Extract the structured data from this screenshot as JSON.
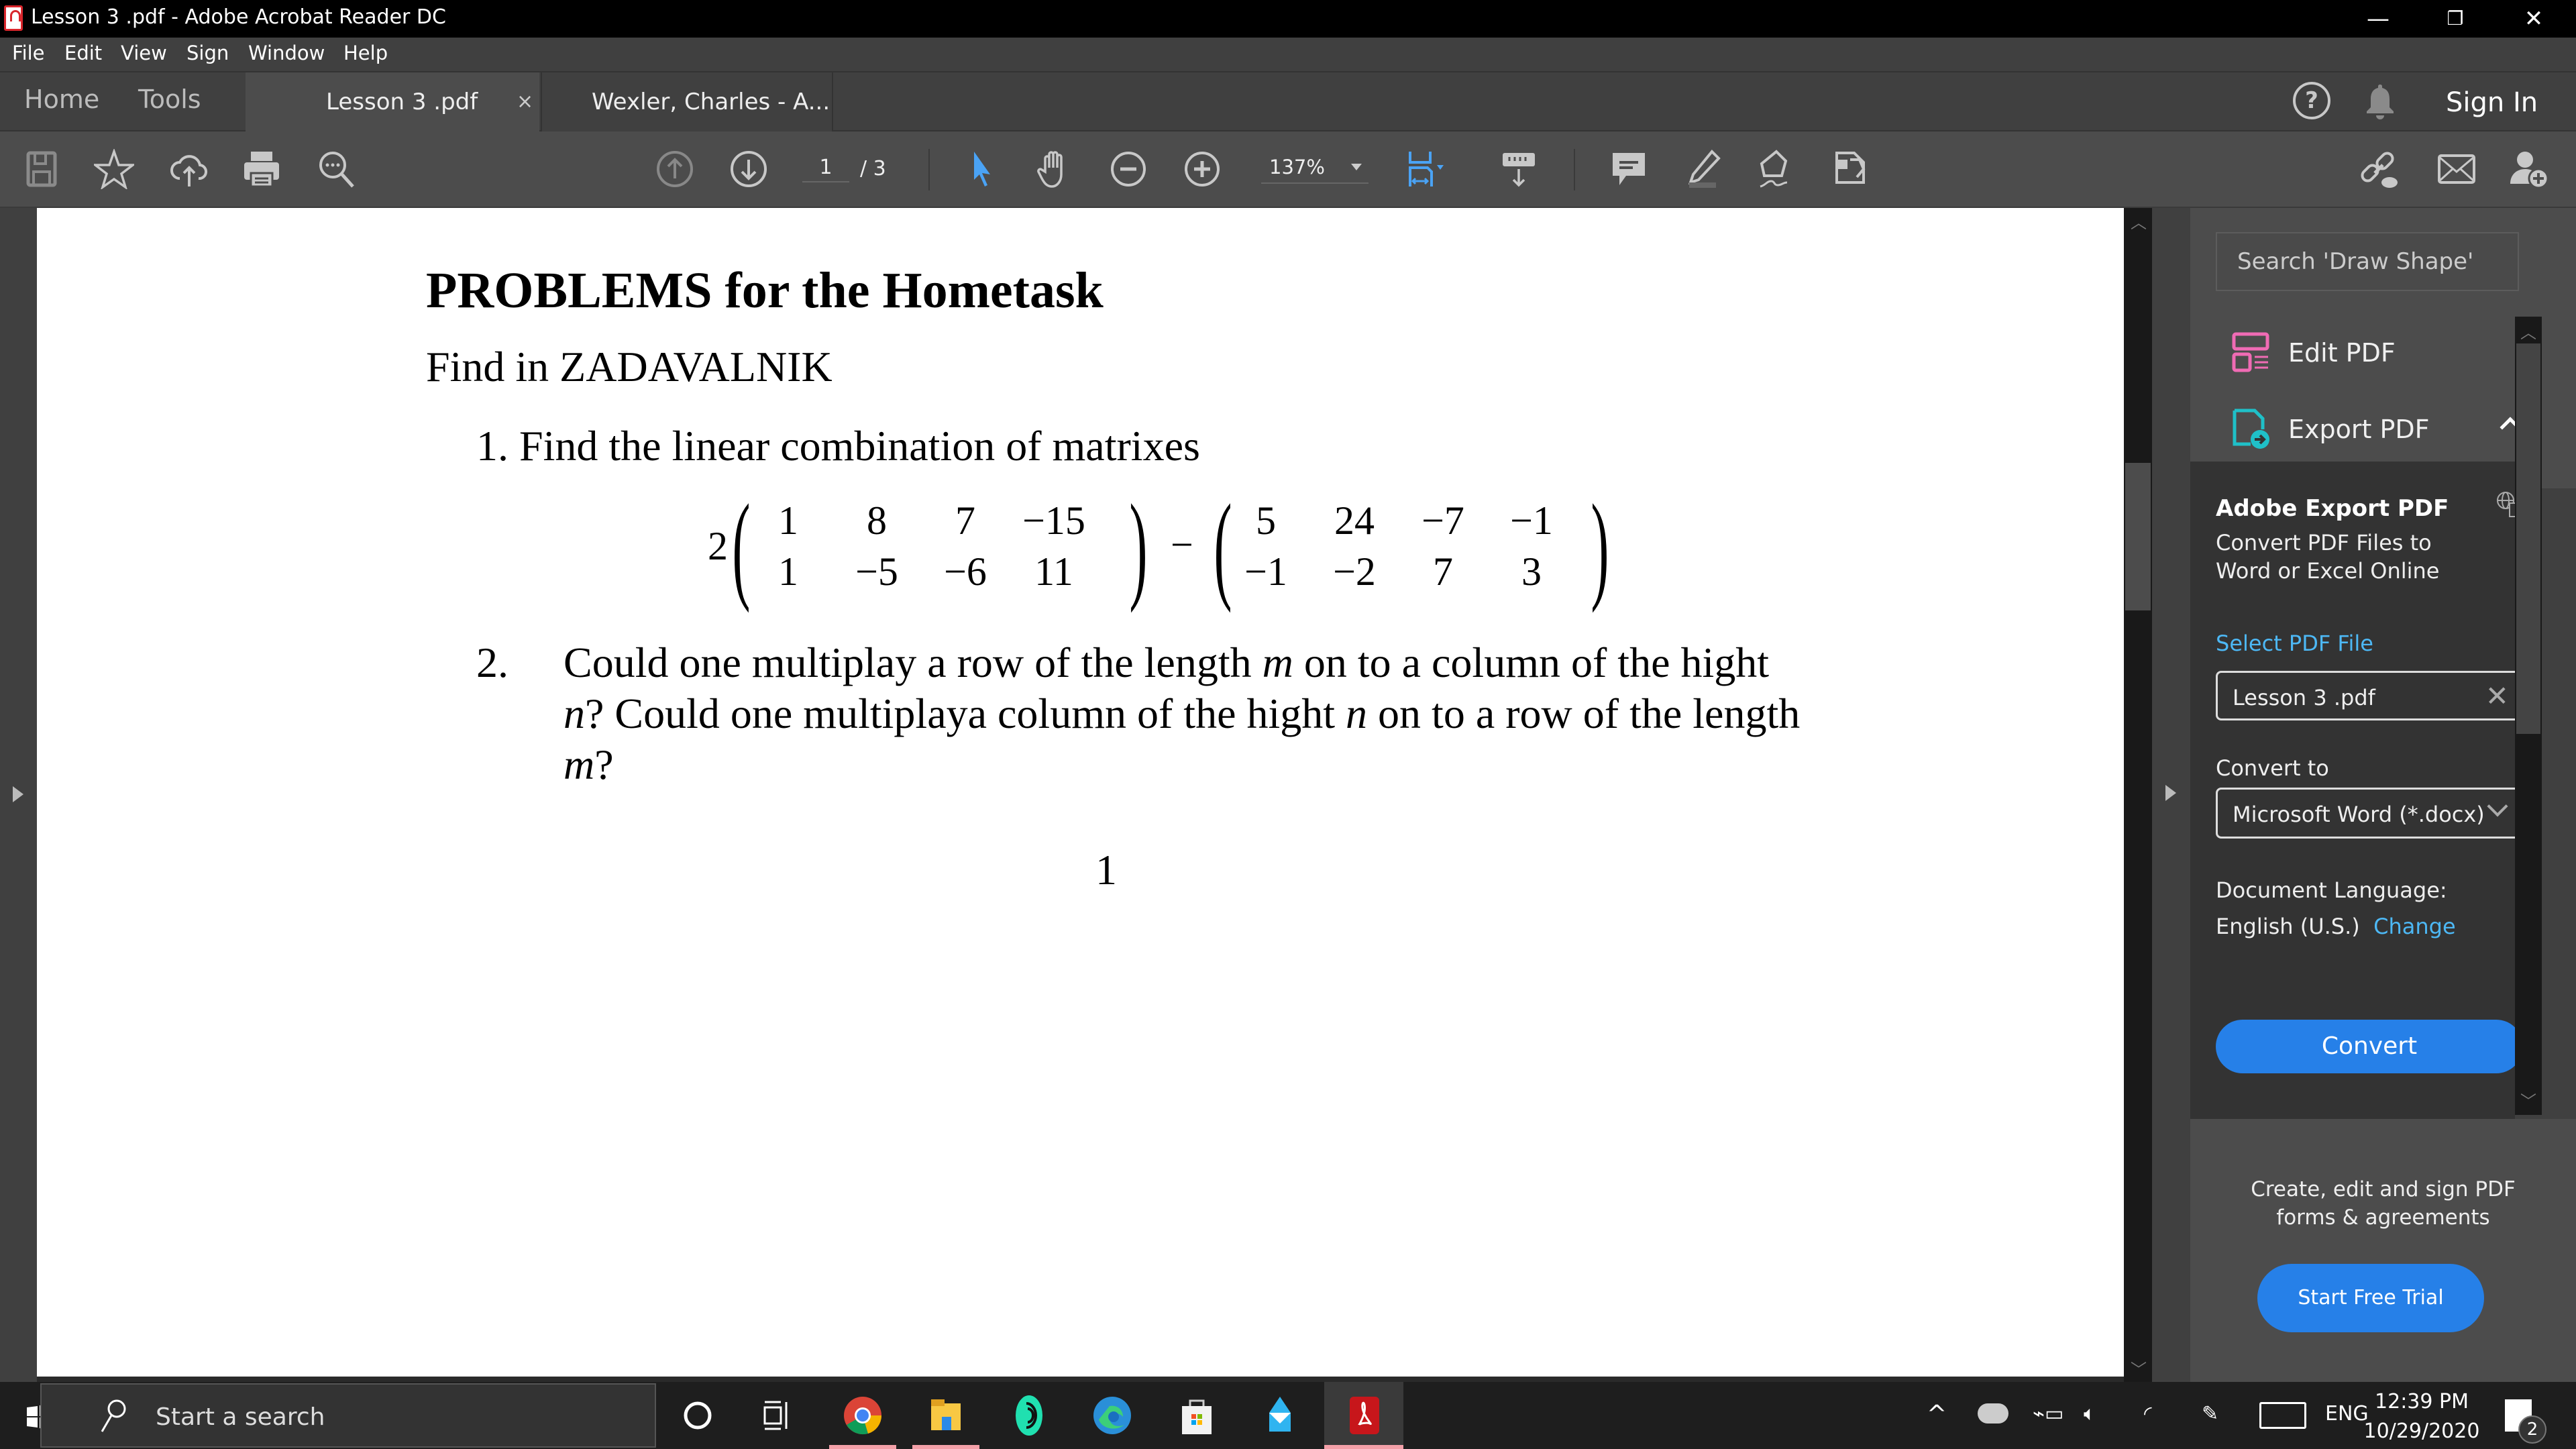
{
  "window": {
    "title": "Lesson 3 .pdf - Adobe Acrobat Reader DC",
    "controls": [
      "minimize",
      "restore",
      "close"
    ]
  },
  "menu": [
    "File",
    "Edit",
    "View",
    "Sign",
    "Window",
    "Help"
  ],
  "tabs": {
    "home": "Home",
    "tools": "Tools",
    "documents": [
      {
        "label": "Lesson 3 .pdf",
        "active": true,
        "close": "×"
      },
      {
        "label": "Wexler, Charles - A...",
        "active": false
      }
    ],
    "sign_in": "Sign In"
  },
  "toolbar": {
    "page_current": "1",
    "page_total": "/ 3",
    "zoom": "137%"
  },
  "document": {
    "heading": "PROBLEMS for the Hometask",
    "subheading": "Find in ZADAVALNIK",
    "problem1": {
      "number": "1.",
      "text": "Find the linear combination of matrixes",
      "coefficient": "2",
      "operator": "−",
      "matrix_a": [
        [
          "1",
          "8",
          "7",
          "−15"
        ],
        [
          "1",
          "−5",
          "−6",
          "11"
        ]
      ],
      "matrix_b": [
        [
          "5",
          "24",
          "−7",
          "−1"
        ],
        [
          "−1",
          "−2",
          "7",
          "3"
        ]
      ]
    },
    "problem2": {
      "number": "2.",
      "line1_a": "Could one multiplay a row of the length ",
      "var_m": "m",
      "line1_b": " on to a column of the hight",
      "var_n": "n",
      "line2_a": "? Could one multiplaya column of the hight ",
      "line2_b": " on to a row of the length",
      "line3": "?"
    },
    "page_number": "1"
  },
  "right_panel": {
    "search_placeholder": "Search 'Draw Shape'",
    "tools": [
      {
        "label": "Edit PDF",
        "color": "#f06bb4"
      },
      {
        "label": "Export PDF",
        "color": "#1fc0c8"
      }
    ],
    "export": {
      "title": "Adobe Export PDF",
      "description": "Convert PDF Files to Word or Excel Online",
      "select_link": "Select PDF File",
      "file_name": "Lesson 3 .pdf",
      "convert_to_label": "Convert to",
      "convert_to_value": "Microsoft Word (*.docx)",
      "language_label": "Document Language:",
      "language_value": "English (U.S.)",
      "change_link": "Change",
      "convert_button": "Convert"
    },
    "promo": {
      "text_line1": "Create, edit and sign PDF",
      "text_line2": "forms & agreements",
      "button": "Start Free Trial"
    }
  },
  "taskbar": {
    "search_placeholder": "Start a search",
    "apps": [
      "cortana",
      "task-view",
      "chrome",
      "file-explorer",
      "app-spiral",
      "edge",
      "microsoft-store",
      "mail",
      "acrobat"
    ],
    "language": "ENG",
    "time": "12:39 PM",
    "date": "10/29/2020",
    "notifications": "2"
  },
  "colors": {
    "accent_blue": "#2680e8",
    "link_blue": "#4db8f5",
    "edit_pink": "#f06bb4",
    "export_teal": "#1fc0c8"
  }
}
